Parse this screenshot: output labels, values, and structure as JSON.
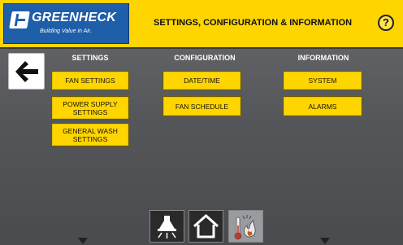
{
  "header": {
    "logo_name": "GREENHECK",
    "logo_tagline": "Building Value in Air.",
    "title": "SETTINGS, CONFIGURATION & INFORMATION",
    "help_label": "?"
  },
  "back": {
    "icon": "left-arrow-icon"
  },
  "columns": [
    {
      "heading": "SETTINGS",
      "buttons": [
        "FAN SETTINGS",
        "POWER SUPPLY\nSETTINGS",
        "GENERAL WASH\nSETTINGS"
      ]
    },
    {
      "heading": "CONFIGURATION",
      "buttons": [
        "DATE/TIME",
        "FAN SCHEDULE"
      ]
    },
    {
      "heading": "INFORMATION",
      "buttons": [
        "SYSTEM",
        "ALARMS"
      ]
    }
  ],
  "bottom_nav": [
    {
      "icon": "lamp-icon"
    },
    {
      "icon": "home-icon"
    },
    {
      "icon": "heat-icon"
    }
  ],
  "colors": {
    "accent": "#ffd500",
    "brand": "#1f5ea8",
    "background": "#58595c"
  }
}
